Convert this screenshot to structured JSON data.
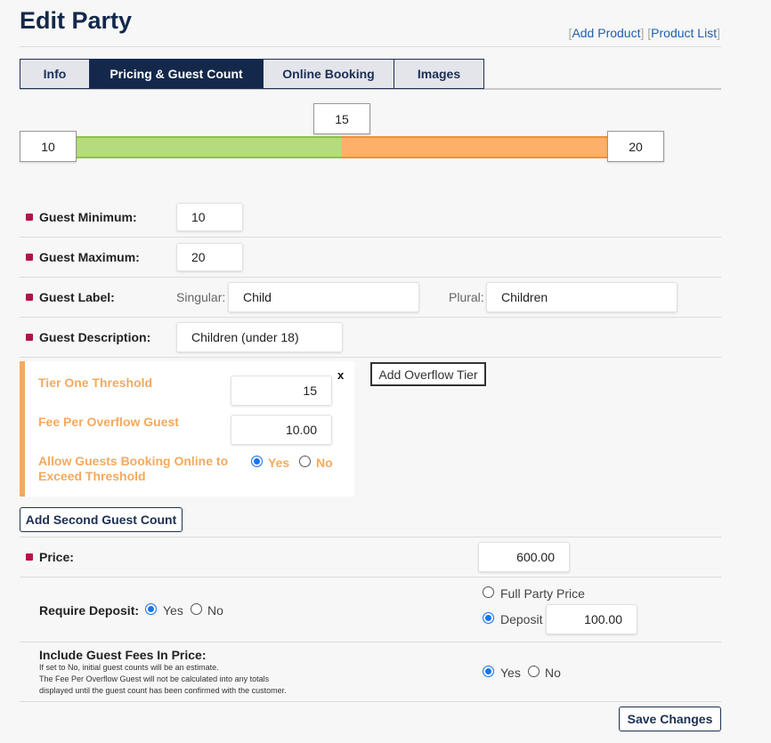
{
  "page": {
    "title": "Edit Party"
  },
  "toplinks": {
    "add_product": "Add Product",
    "product_list": "Product List",
    "open": "[",
    "sep": "] [",
    "close": "]"
  },
  "tabs": [
    {
      "label": "Info"
    },
    {
      "label": "Pricing & Guest Count",
      "active": true
    },
    {
      "label": "Online Booking"
    },
    {
      "label": "Images"
    }
  ],
  "slider": {
    "min": "10",
    "threshold": "15",
    "max": "20",
    "green": "#b5db7d",
    "orange": "#fdb06a"
  },
  "guest": {
    "min_label": "Guest Minimum:",
    "min_value": "10",
    "max_label": "Guest Maximum:",
    "max_value": "20",
    "label_label": "Guest Label:",
    "singular_label": "Singular:",
    "singular_value": "Child",
    "plural_label": "Plural:",
    "plural_value": "Children",
    "desc_label": "Guest Description:",
    "desc_value": "Children (under 18)"
  },
  "tier": {
    "threshold_label": "Tier One Threshold",
    "threshold_value": "15",
    "fee_label": "Fee Per Overflow Guest",
    "fee_value": "10.00",
    "allow_label": "Allow Guests Booking Online to Exceed Threshold",
    "yes": "Yes",
    "no": "No",
    "selected": "Yes",
    "close": "x",
    "accent": "#f5a95e"
  },
  "buttons": {
    "add_overflow": "Add Overflow Tier",
    "add_second": "Add Second Guest Count",
    "save": "Save Changes"
  },
  "price": {
    "label": "Price:",
    "value": "600.00"
  },
  "deposit": {
    "label": "Require Deposit:",
    "yes": "Yes",
    "no": "No",
    "selected": "Yes",
    "full_label": "Full Party Price",
    "deposit_label": "Deposit",
    "deposit_value": "100.00",
    "mode": "Deposit"
  },
  "include_fees": {
    "label": "Include Guest Fees In Price:",
    "note1": "If set to No, initial guest counts will be an estimate.",
    "note2": "The Fee Per Overflow Guest will not be calculated into any totals",
    "note3": "displayed until the guest count has been confirmed with the customer.",
    "yes": "Yes",
    "no": "No",
    "selected": "Yes"
  },
  "colors": {
    "navy": "#13284b",
    "bullet": "#b5124a",
    "radio": "#1a73e8"
  }
}
